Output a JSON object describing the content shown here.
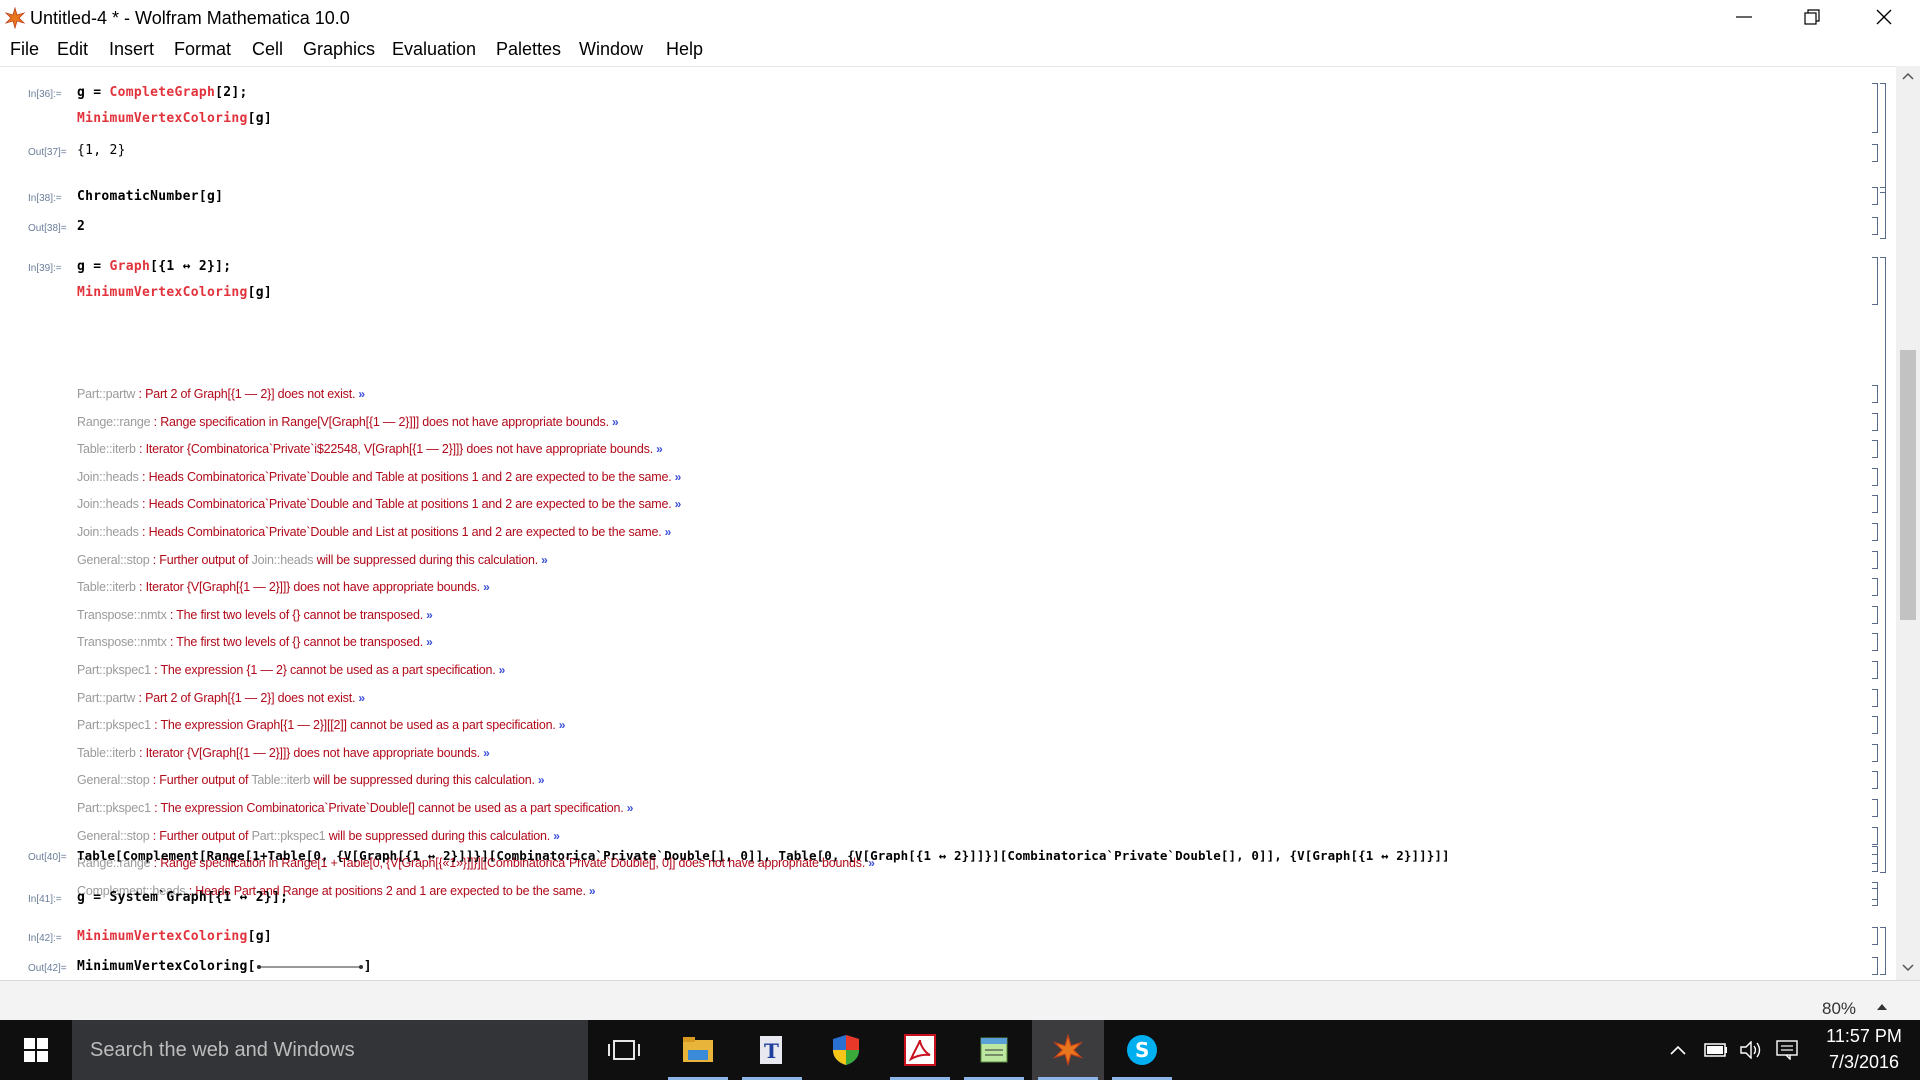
{
  "window": {
    "title": "Untitled-4 * - Wolfram Mathematica 10.0"
  },
  "menu": [
    "File",
    "Edit",
    "Insert",
    "Format",
    "Cell",
    "Graphics",
    "Evaluation",
    "Palettes",
    "Window",
    "Help"
  ],
  "cells": {
    "in36": {
      "label": "In[36]:=",
      "l1_a": "g = ",
      "l1_b": "CompleteGraph",
      "l1_c": "[2];",
      "l2_a": "MinimumVertexColoring",
      "l2_b": "[g]"
    },
    "out37": {
      "label": "Out[37]=",
      "text": "{1, 2}"
    },
    "in38": {
      "label": "In[38]:=",
      "text": "ChromaticNumber[g]"
    },
    "out38": {
      "label": "Out[38]=",
      "text": "2"
    },
    "in39": {
      "label": "In[39]:=",
      "l1_a": "g = ",
      "l1_b": "Graph",
      "l1_c": "[{1 ↔ 2}];",
      "l2_a": "MinimumVertexColoring",
      "l2_b": "[g]"
    },
    "out40": {
      "label": "Out[40]=",
      "text": "Table[Complement[Range[1+Table[0, {V[Graph[{1 ↔ 2}]]}][Combinatorica`Private`Double[], 0]], Table[0, {V[Graph[{1 ↔ 2}]]}][Combinatorica`Private`Double[], 0]], {V[Graph[{1 ↔ 2}]]}]]"
    },
    "in41": {
      "label": "In[41]:=",
      "text": "g = System`Graph[{1 ↔ 2}];"
    },
    "in42": {
      "label": "In[42]:=",
      "a": "MinimumVertexColoring",
      "b": "[g]"
    },
    "out42": {
      "label": "Out[42]=",
      "a": "MinimumVertexColoring[",
      "b": "]"
    }
  },
  "messages": [
    {
      "tag": "Part::partw",
      "parts": [
        "Part 2 of Graph[{1 — 2}] does not exist."
      ]
    },
    {
      "tag": "Range::range",
      "parts": [
        "Range specification in Range[V[Graph[{1 — 2}]]] does not have appropriate bounds."
      ]
    },
    {
      "tag": "Table::iterb",
      "parts": [
        "Iterator {Combinatorica`Private`i$22548, V[Graph[{1 — 2}]]} does not have appropriate bounds."
      ]
    },
    {
      "tag": "Join::heads",
      "parts": [
        "Heads Combinatorica`Private`Double and Table at positions 1 and 2 are expected to be the same."
      ]
    },
    {
      "tag": "Join::heads",
      "parts": [
        "Heads Combinatorica`Private`Double and Table at positions 1 and 2 are expected to be the same."
      ]
    },
    {
      "tag": "Join::heads",
      "parts": [
        "Heads Combinatorica`Private`Double and List at positions 1 and 2 are expected to be the same."
      ]
    },
    {
      "tag": "General::stop",
      "parts": [
        "Further output of ",
        "Join::heads",
        " will be suppressed during this calculation."
      ]
    },
    {
      "tag": "Table::iterb",
      "parts": [
        "Iterator {V[Graph[{1 — 2}]]} does not have appropriate bounds."
      ]
    },
    {
      "tag": "Transpose::nmtx",
      "parts": [
        "The first two levels of {} cannot be transposed."
      ]
    },
    {
      "tag": "Transpose::nmtx",
      "parts": [
        "The first two levels of {} cannot be transposed."
      ]
    },
    {
      "tag": "Part::pkspec1",
      "parts": [
        "The expression {1 — 2} cannot be used as a part specification."
      ]
    },
    {
      "tag": "Part::partw",
      "parts": [
        "Part 2 of Graph[{1 — 2}] does not exist."
      ]
    },
    {
      "tag": "Part::pkspec1",
      "parts": [
        "The expression Graph[{1 — 2}][[2]] cannot be used as a part specification."
      ]
    },
    {
      "tag": "Table::iterb",
      "parts": [
        "Iterator {V[Graph[{1 — 2}]]} does not have appropriate bounds."
      ]
    },
    {
      "tag": "General::stop",
      "parts": [
        "Further output of ",
        "Table::iterb",
        " will be suppressed during this calculation."
      ]
    },
    {
      "tag": "Part::pkspec1",
      "parts": [
        "The expression Combinatorica`Private`Double[] cannot be used as a part specification."
      ]
    },
    {
      "tag": "General::stop",
      "parts": [
        "Further output of ",
        "Part::pkspec1",
        " will be suppressed during this calculation."
      ]
    },
    {
      "tag": "Range::range",
      "parts": [
        "Range specification in Range[1 + Table[0, {V[Graph[{«1»}]]}][[Combinatorica`Private`Double[], 0]] does not have appropriate bounds."
      ]
    },
    {
      "tag": "Complement::heads",
      "parts": [
        "Heads Part and Range at positions 2 and 1 are expected to be the same."
      ]
    }
  ],
  "status": {
    "zoom": "80%"
  },
  "taskbar": {
    "search_placeholder": "Search the web and Windows",
    "time": "11:57 PM",
    "date": "7/3/2016"
  },
  "colors": {
    "function_red": "#e2333c",
    "message_red": "#b10a1a",
    "accent": "#8cb4e6"
  },
  "icons": [
    "mathematica-icon",
    "minimize-icon",
    "maximize-icon",
    "close-icon",
    "windows-start-icon",
    "task-view-icon",
    "file-explorer-icon",
    "typora-icon",
    "security-shield-icon",
    "acrobat-icon",
    "notepad-icon",
    "mathematica-taskbar-icon",
    "skype-icon"
  ]
}
